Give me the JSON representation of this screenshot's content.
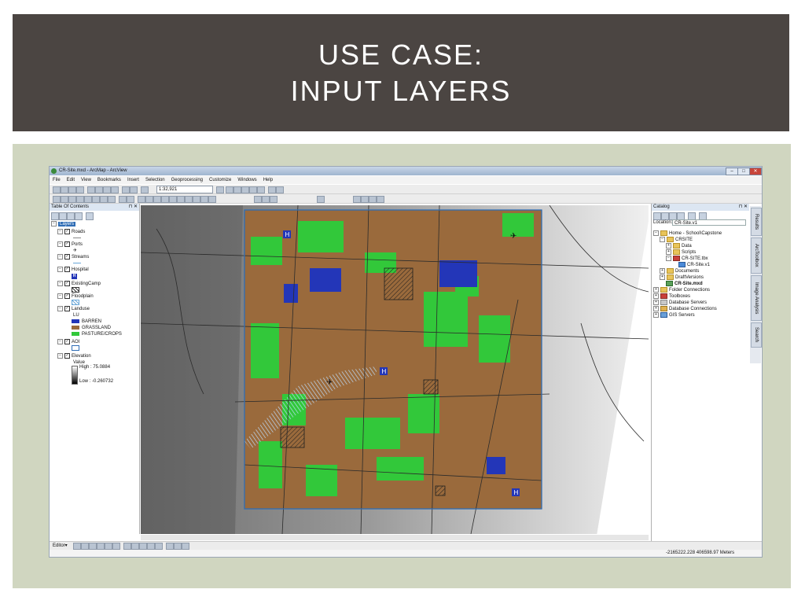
{
  "slide": {
    "title_line1": "USE CASE:",
    "title_line2": "INPUT LAYERS"
  },
  "app": {
    "window_title": "CR-Site.mxd - ArcMap - ArcView",
    "menu": [
      "File",
      "Edit",
      "View",
      "Bookmarks",
      "Insert",
      "Selection",
      "Geoprocessing",
      "Customize",
      "Windows",
      "Help"
    ],
    "scale": "1:32,921",
    "editor_label": "Editor▾",
    "coordinates": "-2165222.228  406598.97 Meters",
    "colors": {
      "accent": "#2f6db5",
      "barren": "#2336b8",
      "grassland": "#9a6a3c",
      "pasture": "#32c83a",
      "aoi": "#2f6db5"
    }
  },
  "toc": {
    "title": "Table Of Contents",
    "root": "Layers",
    "layers": [
      {
        "name": "Roads"
      },
      {
        "name": "Ports"
      },
      {
        "name": "Streams"
      },
      {
        "name": "Hospital"
      },
      {
        "name": "ExistingCamp"
      },
      {
        "name": "Floodplain"
      },
      {
        "name": "Landuse"
      },
      {
        "name": "AOI"
      },
      {
        "name": "Elevation"
      }
    ],
    "landuse_field": "LU",
    "landuse_classes": [
      "BARREN",
      "GRASSLAND",
      "PASTURE/CROPS"
    ],
    "elevation_value_label": "Value",
    "elevation_high": "High : 75.0884",
    "elevation_low": "Low : -0.260732"
  },
  "catalog": {
    "title": "Catalog",
    "location_label": "Location:",
    "location_value": "CR-Site.v1",
    "tree": [
      {
        "label": "Home - School\\Capstone",
        "depth": 0
      },
      {
        "label": "CRSITE",
        "depth": 1
      },
      {
        "label": "Data",
        "depth": 2
      },
      {
        "label": "Scripts",
        "depth": 2
      },
      {
        "label": "CR-SITE.tbx",
        "depth": 2
      },
      {
        "label": "CR-Site.v1",
        "depth": 3
      },
      {
        "label": "Documents",
        "depth": 1
      },
      {
        "label": "DraftVersions",
        "depth": 1
      },
      {
        "label": "CR-Site.mxd",
        "depth": 1
      },
      {
        "label": "Folder Connections",
        "depth": 0
      },
      {
        "label": "Toolboxes",
        "depth": 0
      },
      {
        "label": "Database Servers",
        "depth": 0
      },
      {
        "label": "Database Connections",
        "depth": 0
      },
      {
        "label": "GIS Servers",
        "depth": 0
      }
    ],
    "side_tabs": [
      "Results",
      "ArcToolbox",
      "Image Analysis",
      "Search"
    ]
  },
  "map": {
    "hospital_marker": "H"
  }
}
